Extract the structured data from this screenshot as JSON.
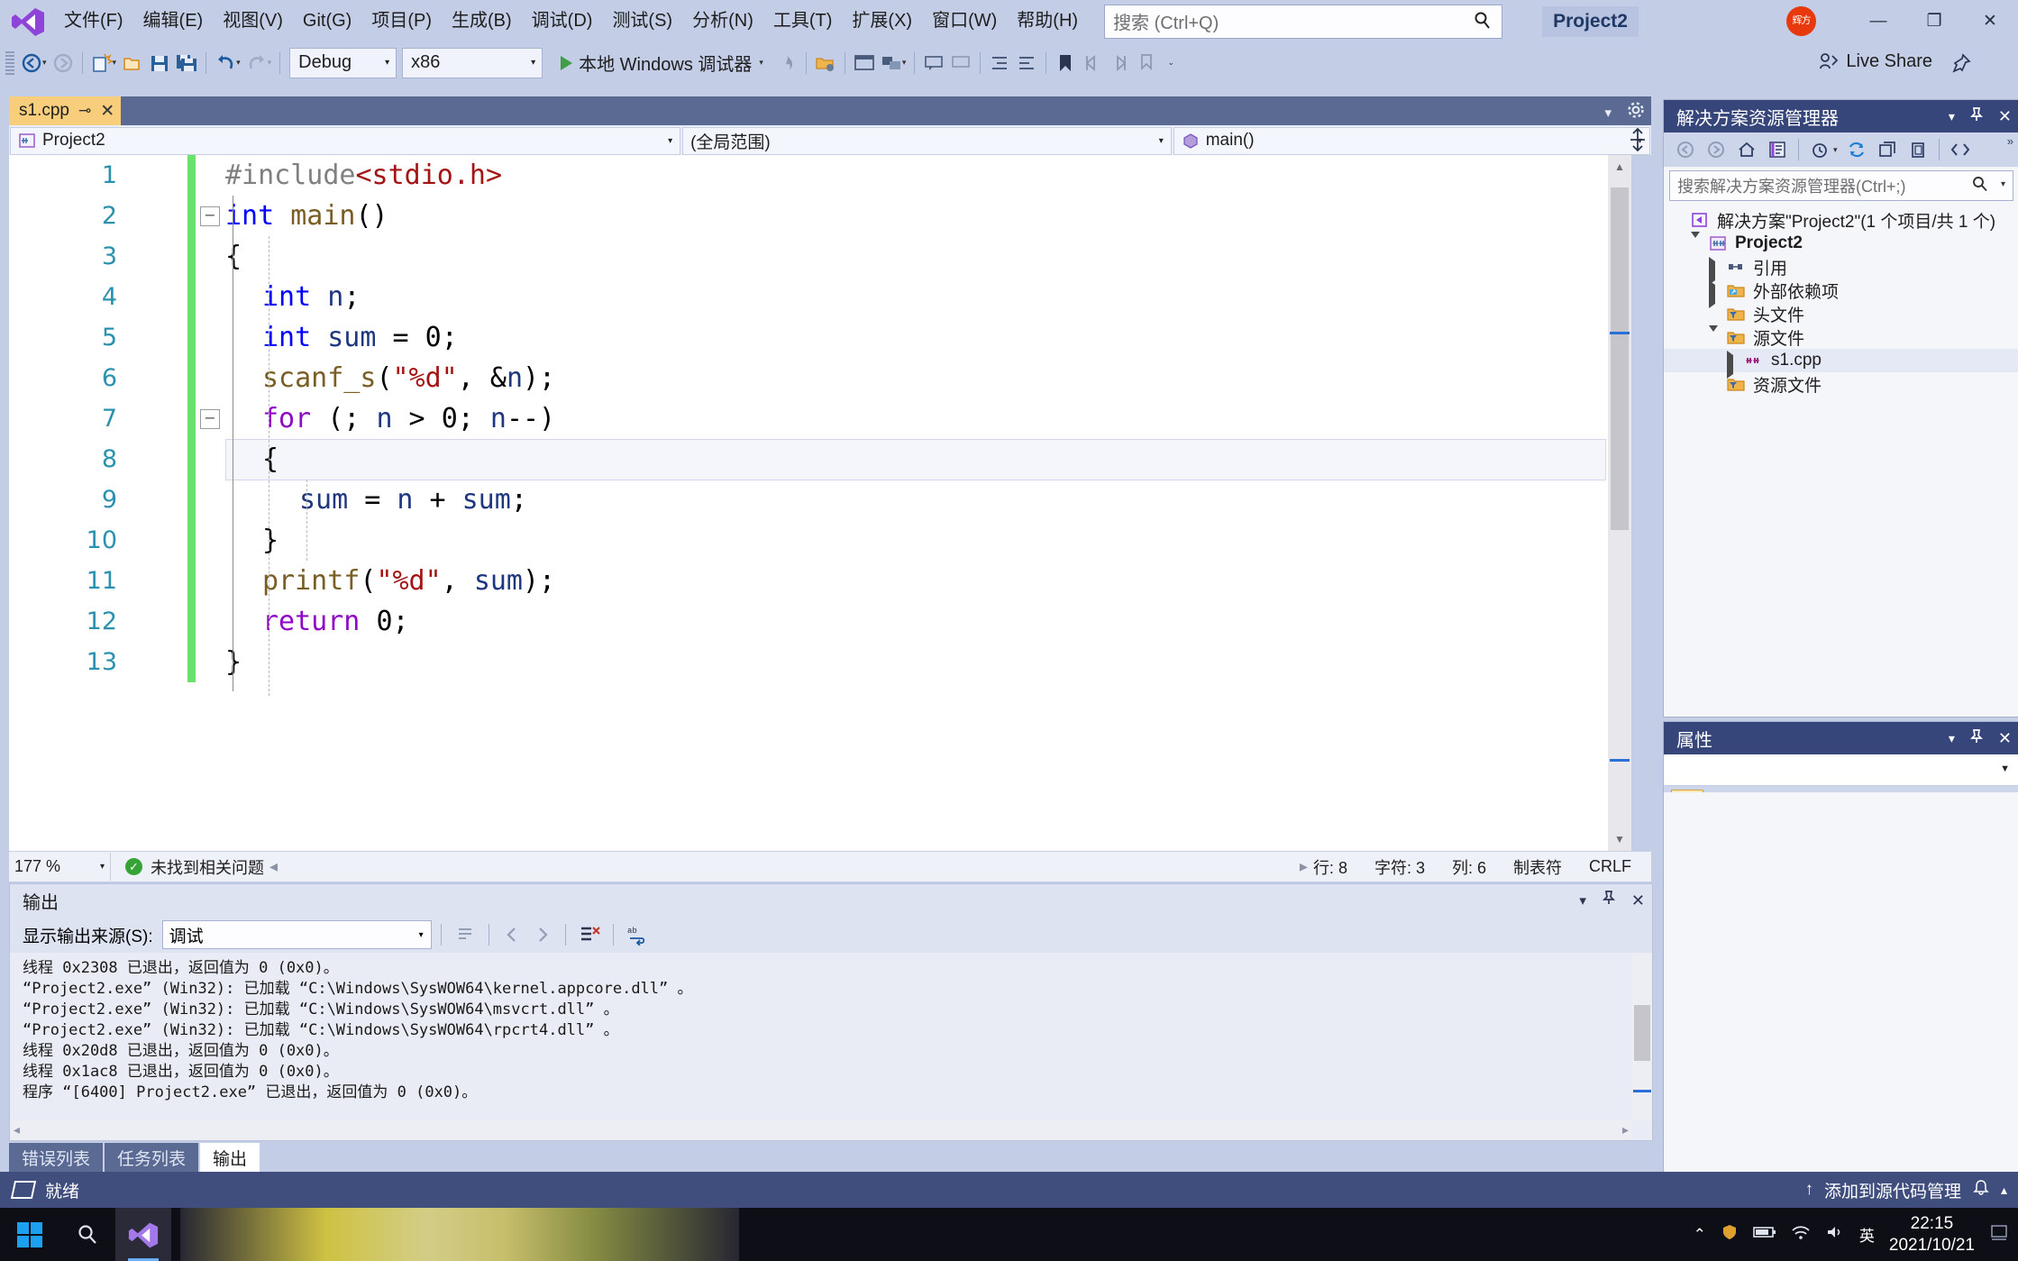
{
  "window": {
    "title": "Project2",
    "avatar_initials": "辉方",
    "minimize": "—",
    "maximize": "❐",
    "close": "✕"
  },
  "menubar": {
    "items": [
      {
        "label": "文件(F)",
        "name": "menu-file"
      },
      {
        "label": "编辑(E)",
        "name": "menu-edit"
      },
      {
        "label": "视图(V)",
        "name": "menu-view"
      },
      {
        "label": "Git(G)",
        "name": "menu-git"
      },
      {
        "label": "项目(P)",
        "name": "menu-project"
      },
      {
        "label": "生成(B)",
        "name": "menu-build"
      },
      {
        "label": "调试(D)",
        "name": "menu-debug"
      },
      {
        "label": "测试(S)",
        "name": "menu-test"
      },
      {
        "label": "分析(N)",
        "name": "menu-analyze"
      },
      {
        "label": "工具(T)",
        "name": "menu-tools"
      },
      {
        "label": "扩展(X)",
        "name": "menu-extensions"
      },
      {
        "label": "窗口(W)",
        "name": "menu-window"
      },
      {
        "label": "帮助(H)",
        "name": "menu-help"
      }
    ],
    "search_placeholder": "搜索 (Ctrl+Q)"
  },
  "toolbar": {
    "configuration": "Debug",
    "platform": "x86",
    "run_label": "本地 Windows 调试器",
    "live_share": "Live Share"
  },
  "document_tab": {
    "title": "s1.cpp",
    "pin": "⊸",
    "close": "✕"
  },
  "navbar": {
    "project": "Project2",
    "scope": "(全局范围)",
    "member": "main()"
  },
  "editor": {
    "lines": [
      {
        "n": "1",
        "indent": 0,
        "tokens": [
          {
            "t": "#include",
            "c": "pre"
          },
          {
            "t": "<stdio.h>",
            "c": "inc"
          }
        ]
      },
      {
        "n": "2",
        "indent": 0,
        "fold": "−",
        "tokens": [
          {
            "t": "int",
            "c": "k"
          },
          {
            "t": " ",
            "c": "pl"
          },
          {
            "t": "main",
            "c": "fn"
          },
          {
            "t": "()",
            "c": "pl"
          }
        ]
      },
      {
        "n": "3",
        "indent": 0,
        "tokens": [
          {
            "t": "{",
            "c": "pl"
          }
        ]
      },
      {
        "n": "4",
        "indent": 1,
        "tokens": [
          {
            "t": "int",
            "c": "k"
          },
          {
            "t": " ",
            "c": "pl"
          },
          {
            "t": "n",
            "c": "id"
          },
          {
            "t": ";",
            "c": "pl"
          }
        ]
      },
      {
        "n": "5",
        "indent": 1,
        "tokens": [
          {
            "t": "int",
            "c": "k"
          },
          {
            "t": " ",
            "c": "pl"
          },
          {
            "t": "sum",
            "c": "id"
          },
          {
            "t": " = ",
            "c": "pl"
          },
          {
            "t": "0",
            "c": "pl"
          },
          {
            "t": ";",
            "c": "pl"
          }
        ]
      },
      {
        "n": "6",
        "indent": 1,
        "tokens": [
          {
            "t": "scanf_s",
            "c": "fn"
          },
          {
            "t": "(",
            "c": "pl"
          },
          {
            "t": "\"%d\"",
            "c": "str"
          },
          {
            "t": ", &",
            "c": "pl"
          },
          {
            "t": "n",
            "c": "id"
          },
          {
            "t": ");",
            "c": "pl"
          }
        ]
      },
      {
        "n": "7",
        "indent": 1,
        "fold": "−",
        "tokens": [
          {
            "t": "for",
            "c": "kw2"
          },
          {
            "t": " (; ",
            "c": "pl"
          },
          {
            "t": "n",
            "c": "id"
          },
          {
            "t": " > ",
            "c": "pl"
          },
          {
            "t": "0",
            "c": "pl"
          },
          {
            "t": "; ",
            "c": "pl"
          },
          {
            "t": "n",
            "c": "id"
          },
          {
            "t": "--)",
            "c": "pl"
          }
        ]
      },
      {
        "n": "8",
        "indent": 1,
        "current": true,
        "tokens": [
          {
            "t": "{",
            "c": "pl"
          }
        ]
      },
      {
        "n": "9",
        "indent": 2,
        "tokens": [
          {
            "t": "sum",
            "c": "id"
          },
          {
            "t": " = ",
            "c": "pl"
          },
          {
            "t": "n",
            "c": "id"
          },
          {
            "t": " + ",
            "c": "pl"
          },
          {
            "t": "sum",
            "c": "id"
          },
          {
            "t": ";",
            "c": "pl"
          }
        ]
      },
      {
        "n": "10",
        "indent": 1,
        "tokens": [
          {
            "t": "}",
            "c": "pl"
          }
        ]
      },
      {
        "n": "11",
        "indent": 1,
        "tokens": [
          {
            "t": "printf",
            "c": "fn"
          },
          {
            "t": "(",
            "c": "pl"
          },
          {
            "t": "\"%d\"",
            "c": "str"
          },
          {
            "t": ", ",
            "c": "pl"
          },
          {
            "t": "sum",
            "c": "id"
          },
          {
            "t": ");",
            "c": "pl"
          }
        ]
      },
      {
        "n": "12",
        "indent": 1,
        "tokens": [
          {
            "t": "return",
            "c": "kw2"
          },
          {
            "t": " ",
            "c": "pl"
          },
          {
            "t": "0",
            "c": "pl"
          },
          {
            "t": ";",
            "c": "pl"
          }
        ]
      },
      {
        "n": "13",
        "indent": 0,
        "tokens": [
          {
            "t": "}",
            "c": "pl"
          }
        ]
      }
    ]
  },
  "editor_status": {
    "zoom": "177 %",
    "issues": "未找到相关问题",
    "line": "行: 8",
    "char": "字符: 3",
    "col": "列: 6",
    "tabs": "制表符",
    "eol": "CRLF"
  },
  "output": {
    "title": "输出",
    "source_label": "显示输出来源(S):",
    "source_value": "调试",
    "text": "线程 0x2308 已退出，返回值为 0 (0x0)。\n“Project2.exe” (Win32): 已加载 “C:\\Windows\\SysWOW64\\kernel.appcore.dll” 。\n“Project2.exe” (Win32): 已加载 “C:\\Windows\\SysWOW64\\msvcrt.dll” 。\n“Project2.exe” (Win32): 已加载 “C:\\Windows\\SysWOW64\\rpcrt4.dll” 。\n线程 0x20d8 已退出，返回值为 0 (0x0)。\n线程 0x1ac8 已退出，返回值为 0 (0x0)。\n程序 “[6400] Project2.exe” 已退出，返回值为 0 (0x0)。"
  },
  "bottom_tabs": [
    {
      "label": "错误列表",
      "name": "tab-error-list",
      "active": false
    },
    {
      "label": "任务列表",
      "name": "tab-task-list",
      "active": false
    },
    {
      "label": "输出",
      "name": "tab-output",
      "active": true
    }
  ],
  "solution_explorer": {
    "title": "解决方案资源管理器",
    "search_placeholder": "搜索解决方案资源管理器(Ctrl+;)",
    "tree": [
      {
        "label": "解决方案\"Project2\"(1 个项目/共 1 个)",
        "indent": 0,
        "twisty": "none",
        "icon": "solution-icon",
        "bold": false,
        "selected": false
      },
      {
        "label": "Project2",
        "indent": 1,
        "twisty": "down",
        "icon": "project-cpp-icon",
        "bold": true,
        "selected": false
      },
      {
        "label": "引用",
        "indent": 2,
        "twisty": "right",
        "icon": "references-icon",
        "bold": false,
        "selected": false
      },
      {
        "label": "外部依赖项",
        "indent": 2,
        "twisty": "right",
        "icon": "ext-deps-icon",
        "bold": false,
        "selected": false
      },
      {
        "label": "头文件",
        "indent": 2,
        "twisty": "none",
        "icon": "filter-folder-icon",
        "bold": false,
        "selected": false
      },
      {
        "label": "源文件",
        "indent": 2,
        "twisty": "down",
        "icon": "filter-folder-icon",
        "bold": false,
        "selected": false
      },
      {
        "label": "s1.cpp",
        "indent": 3,
        "twisty": "right",
        "icon": "cpp-file-icon",
        "bold": false,
        "selected": true
      },
      {
        "label": "资源文件",
        "indent": 2,
        "twisty": "none",
        "icon": "filter-folder-icon",
        "bold": false,
        "selected": false
      }
    ]
  },
  "properties": {
    "title": "属性"
  },
  "statusbar": {
    "ready": "就绪",
    "source_control": "添加到源代码管理"
  },
  "taskbar": {
    "ime": "英",
    "time": "22:15",
    "date": "2021/10/21"
  },
  "colors": {
    "chrome": "#c3cde6",
    "panel_header": "#36457a",
    "statusbar": "#3f4e7d",
    "tab_active": "#f8cd7c",
    "keyword": "#0000ff",
    "keyword_control": "#8f08c4",
    "function": "#795e26",
    "string": "#a31515",
    "identifier": "#1f377f",
    "preprocessor": "#808080",
    "changed_marker": "#6ce06c",
    "accent_blue": "#1ca0f2"
  }
}
